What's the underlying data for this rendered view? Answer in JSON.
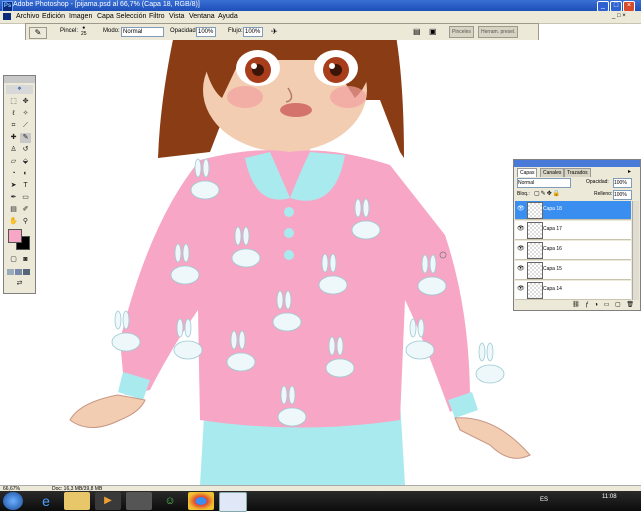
{
  "window": {
    "title": "Adobe Photoshop - [pijama.psd al 66,7% (Capa 18, RGB/8)]",
    "app_icon": "Ps"
  },
  "menu": [
    "Archivo",
    "Edición",
    "Imagen",
    "Capa",
    "Selección",
    "Filtro",
    "Vista",
    "Ventana",
    "Ayuda"
  ],
  "options_bar": {
    "brush_label": "Pincel:",
    "brush_size": "25",
    "mode_label": "Modo:",
    "mode_value": "Normal",
    "opacity_label": "Opacidad:",
    "opacity_value": "100%",
    "flow_label": "Flujo:",
    "flow_value": "100%",
    "tab_brushes": "Pinceles",
    "tab_presets": "Herram. presel."
  },
  "layers_panel": {
    "tabs": [
      "Capas",
      "Canales",
      "Trazados"
    ],
    "blend_mode": "Normal",
    "opacity_label": "Opacidad:",
    "opacity_value": "100%",
    "lock_label": "Bloq.:",
    "fill_label": "Relleno:",
    "fill_value": "100%",
    "layers": [
      {
        "name": "Capa 18",
        "selected": true
      },
      {
        "name": "Capa 17",
        "selected": false
      },
      {
        "name": "Capa 16",
        "selected": false
      },
      {
        "name": "Capa 15",
        "selected": false
      },
      {
        "name": "Capa 14",
        "selected": false
      }
    ]
  },
  "status_bar": {
    "zoom": "66,67%",
    "doc_info": "Doc: 16,3 MB/39,8 MB"
  },
  "taskbar": {
    "language": "ES",
    "time": "11:08",
    "apps": [
      "start-orb-icon",
      "ie-icon",
      "folder-icon",
      "media-player-icon",
      "winamp-icon",
      "messenger-icon",
      "chrome-icon",
      "photoshop-icon"
    ]
  },
  "colors": {
    "foreground": "#f7a6c6",
    "background": "#000000",
    "sweater": "#f7a6c6",
    "collar": "#a9eaee",
    "hair": "#8a3d14"
  }
}
